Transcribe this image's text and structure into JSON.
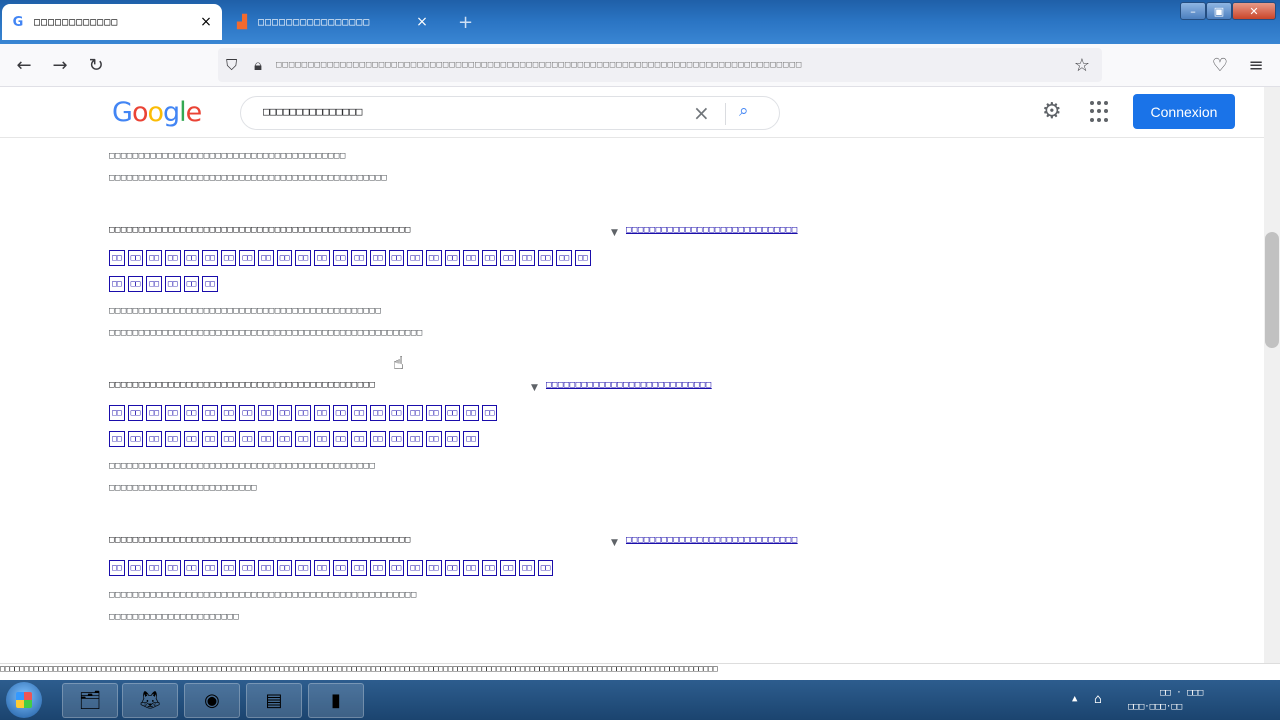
{
  "browser": {
    "tabs": [
      {
        "title": "□□□□□□□□□□□□",
        "icon": "google-icon",
        "active": true
      },
      {
        "title": "□□□□□□□□□□□□□□□□",
        "icon": "chart-icon",
        "active": false
      }
    ],
    "new_tab_label": "+",
    "url": "□□□□□□□□□□□□□□□□□□□□□□□□□□□□□□□□□□□□□□□□□□□□□□□□□□□□□□□□□□□□□□□□□□□□□□□□□□□□□□□□□□"
  },
  "google": {
    "logo_text": "Google",
    "query": "□□□□□□□□□□□□□□□",
    "signin_label": "Connexion"
  },
  "results": [
    {
      "lines_top": [
        "□□□□□□□□□□□□□□□□□□□□□□□□□□□□□□□□□□□□□□□□",
        "□□□□□□□□□□□□□□□□□□□□□□□□□□□□□□□□□□□□□□□□□□□□□□□"
      ]
    },
    {
      "url": "□□□□□□□□□□□□□□□□□□□□□□□□□□□□□□□□□□□□□□□□□□□□□□□□□□□",
      "url_link": "□□□□□□□□□□□□□□□□□□□□□□□□□□□□□",
      "title_boxes": [
        "□□",
        "□□",
        "□□",
        "□□",
        "□□",
        "□□",
        "□□",
        "□□",
        "□□",
        "□□",
        "□□",
        "□□",
        "□□",
        "□□",
        "□□",
        "□□",
        "□□",
        "□□",
        "□□",
        "□□",
        "□□",
        "□□",
        "□□",
        "□□",
        "□□",
        "□□"
      ],
      "title_boxes2": [
        "□□",
        "□□",
        "□□",
        "□□",
        "□□",
        "□□"
      ],
      "snippet": [
        "□□□□□□□□□□□□□□□□□□□□□□□□□□□□□□□□□□□□□□□□□□□□□□",
        "□□□□□□□□□□□□□□□□□□□□□□□□□□□□□□□□□□□□□□□□□□□□□□□□□□□□□"
      ]
    },
    {
      "url": "□□□□□□□□□□□□□□□□□□□□□□□□□□□□□□□□□□□□□□□□□□□□□",
      "url_link": "□□□□□□□□□□□□□□□□□□□□□□□□□□□□",
      "title_boxes": [
        "□□",
        "□□",
        "□□",
        "□□",
        "□□",
        "□□",
        "□□",
        "□□",
        "□□",
        "□□",
        "□□",
        "□□",
        "□□",
        "□□",
        "□□",
        "□□",
        "□□",
        "□□",
        "□□",
        "□□",
        "□□"
      ],
      "title_boxes2": [
        "□□",
        "□□",
        "□□",
        "□□",
        "□□",
        "□□",
        "□□",
        "□□",
        "□□",
        "□□",
        "□□",
        "□□",
        "□□",
        "□□",
        "□□",
        "□□",
        "□□",
        "□□",
        "□□",
        "□□"
      ],
      "snippet": [
        "□□□□□□□□□□□□□□□□□□□□□□□□□□□□□□□□□□□□□□□□□□□□□",
        "□□□□□□□□□□□□□□□□□□□□□□□□□"
      ]
    },
    {
      "url": "□□□□□□□□□□□□□□□□□□□□□□□□□□□□□□□□□□□□□□□□□□□□□□□□□□□",
      "url_link": "□□□□□□□□□□□□□□□□□□□□□□□□□□□□□",
      "title_boxes": [
        "□□",
        "□□",
        "□□",
        "□□",
        "□□",
        "□□",
        "□□",
        "□□",
        "□□",
        "□□",
        "□□",
        "□□",
        "□□",
        "□□",
        "□□",
        "□□",
        "□□",
        "□□",
        "□□",
        "□□",
        "□□",
        "□□",
        "□□",
        "□□"
      ],
      "snippet": [
        "□□□□□□□□□□□□□□□□□□□□□□□□□□□□□□□□□□□□□□□□□□□□□□□□□□□□",
        "□□□□□□□□□□□□□□□□□□□□□□"
      ]
    }
  ],
  "status_text": "□□□□□□□□□□□□□□□□□□□□□□□□□□□□□□□□□□□□□□□□□□□□□□□□□□□□□□□□□□□□□□□□□□□□□□□□□□□□□□□□□□□□□□□□□□□□□□□□□□□□□□□□□□□□□□□□□□□□□□□□□□□□□□□□□□□□□□□□□□□□□□□□□□□□□",
  "taskbar": {
    "apps": [
      "explorer-icon",
      "firefox-icon",
      "chrome-icon",
      "document-icon",
      "folder-icon"
    ],
    "clock_time": "□□ · □□□",
    "clock_date": "□□□·□□□·□□"
  }
}
